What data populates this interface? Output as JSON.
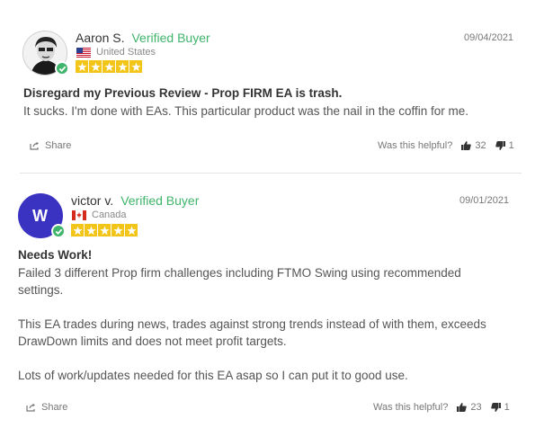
{
  "helpful_label": "Was this helpful?",
  "share_label": "Share",
  "verified_label": "Verified Buyer",
  "colors": {
    "verified": "#3fb46b",
    "star": "#f4c519",
    "avatar_bg": "#3a33c2"
  },
  "reviews": [
    {
      "name": "Aaron S.",
      "date": "09/04/2021",
      "country": "United States",
      "flag_icon": "us-flag-icon",
      "rating": 5,
      "title": "Disregard my Previous Review - Prop FIRM EA is trash.",
      "paragraphs": [
        "It sucks. I'm done with EAs. This particular product was the nail in the coffin for me."
      ],
      "helpful_yes": "32",
      "helpful_no": "1"
    },
    {
      "name": "victor v.",
      "avatar_initial": "W",
      "date": "09/01/2021",
      "country": "Canada",
      "flag_icon": "canada-flag-icon",
      "rating": 5,
      "title": "Needs Work!",
      "paragraphs": [
        "Failed 3 different Prop firm challenges including FTMO Swing using recommended settings.",
        "This EA trades during news, trades against strong trends instead of with them, exceeds DrawDown limits and does not meet profit targets.",
        "Lots of work/updates needed for this EA asap so I can put it to good use."
      ],
      "helpful_yes": "23",
      "helpful_no": "1"
    }
  ]
}
